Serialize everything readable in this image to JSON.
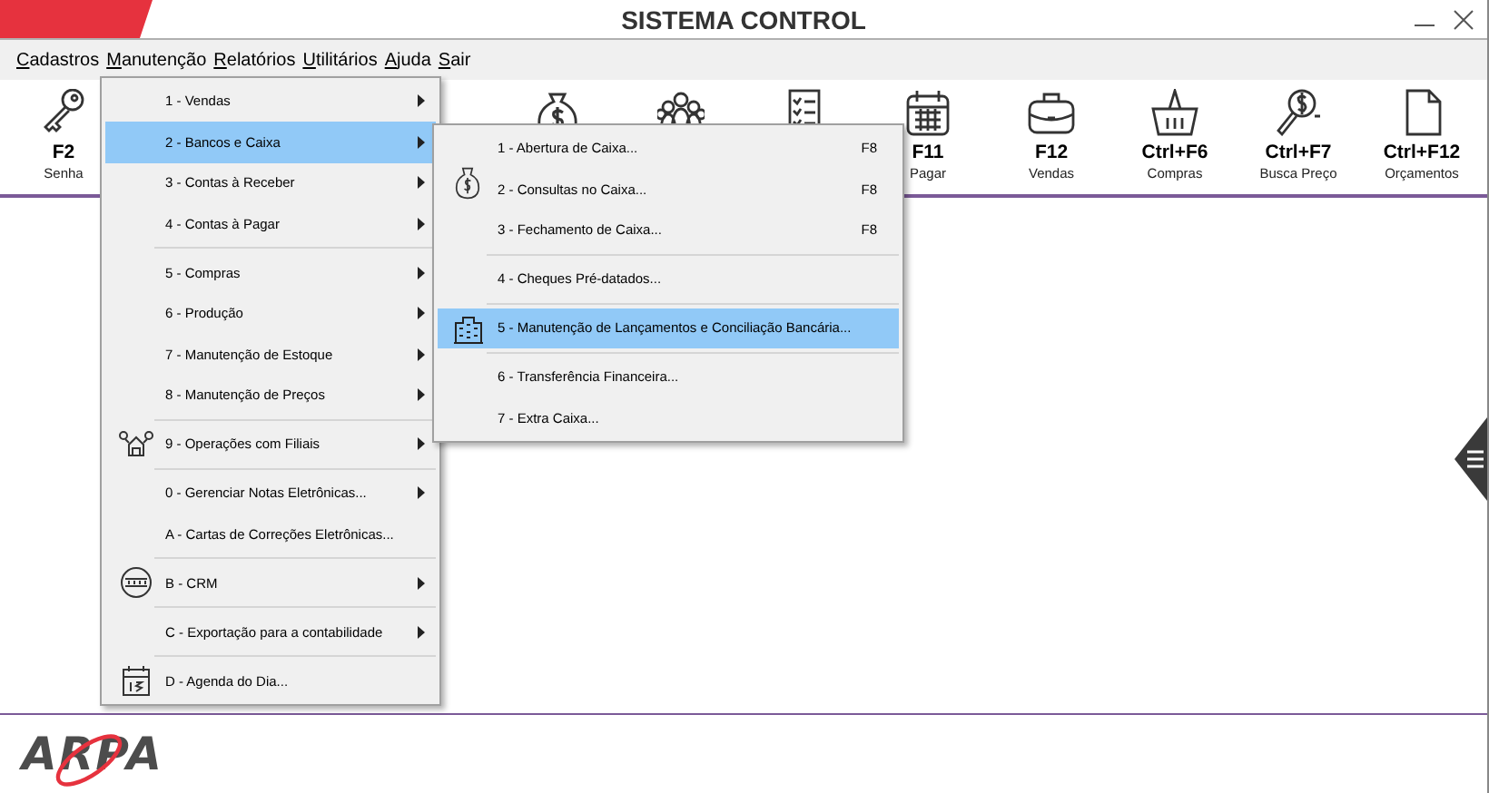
{
  "window": {
    "title": "SISTEMA CONTROL"
  },
  "menubar": [
    {
      "label": "Cadastros"
    },
    {
      "label": "Manutenção"
    },
    {
      "label": "Relatórios"
    },
    {
      "label": "Utilitários"
    },
    {
      "label": "Ajuda"
    },
    {
      "label": "Sair"
    }
  ],
  "toolbar": [
    {
      "kind": "key",
      "key": "F2",
      "label": "Senha"
    },
    {
      "kind": "blank"
    },
    {
      "kind": "blank"
    },
    {
      "kind": "blank"
    },
    {
      "kind": "money"
    },
    {
      "kind": "people"
    },
    {
      "kind": "checklist"
    },
    {
      "kind": "calendar",
      "key": "F11",
      "label": "Pagar"
    },
    {
      "kind": "briefcase",
      "key": "F12",
      "label": "Vendas"
    },
    {
      "kind": "basket",
      "key": "Ctrl+F6",
      "label": "Compras"
    },
    {
      "kind": "price",
      "key": "Ctrl+F7",
      "label": "Busca Preço"
    },
    {
      "kind": "document",
      "key": "Ctrl+F12",
      "label": "Orçamentos"
    }
  ],
  "menu": {
    "groups": [
      [
        {
          "label": "1 - Vendas",
          "submenu": true,
          "selected": false,
          "kind": "plain"
        },
        {
          "label": "2 - Bancos e Caixa",
          "submenu": true,
          "selected": true,
          "kind": "plain"
        },
        {
          "label": "3 - Contas à Receber",
          "submenu": true,
          "selected": false,
          "kind": "plain"
        },
        {
          "label": "4 - Contas à Pagar",
          "submenu": true,
          "selected": false,
          "kind": "plain"
        }
      ],
      [
        {
          "label": "5 - Compras",
          "submenu": true,
          "selected": false,
          "kind": "plain"
        },
        {
          "label": "6 - Produção",
          "submenu": true,
          "selected": false,
          "kind": "plain"
        },
        {
          "label": "7 - Manutenção de Estoque",
          "submenu": true,
          "selected": false,
          "kind": "plain"
        },
        {
          "label": "8 - Manutenção de Preços",
          "submenu": true,
          "selected": false,
          "kind": "plain"
        }
      ],
      [
        {
          "label": "9 - Operações com Filiais",
          "submenu": true,
          "selected": false,
          "kind": "network"
        }
      ],
      [
        {
          "label": "0 - Gerenciar Notas Eletrônicas...",
          "submenu": true,
          "selected": false,
          "kind": "plain"
        },
        {
          "label": "A - Cartas de Correções Eletrônicas...",
          "submenu": false,
          "selected": false,
          "kind": "plain"
        }
      ],
      [
        {
          "label": "B - CRM",
          "submenu": true,
          "selected": false,
          "kind": "crm"
        }
      ],
      [
        {
          "label": "C - Exportação para a contabilidade",
          "submenu": true,
          "selected": false,
          "kind": "plain"
        }
      ],
      [
        {
          "label": "D - Agenda do Dia...",
          "submenu": false,
          "selected": false,
          "kind": "calendar"
        }
      ]
    ]
  },
  "submenu": {
    "groups": [
      [
        {
          "label": "1 - Abertura de Caixa...",
          "shortcut": "F8",
          "selected": false,
          "kind": "plain"
        },
        {
          "label": "2 - Consultas no Caixa...",
          "shortcut": "F8",
          "selected": false,
          "kind": "money"
        },
        {
          "label": "3 - Fechamento de Caixa...",
          "shortcut": "F8",
          "selected": false,
          "kind": "plain"
        }
      ],
      [
        {
          "label": "4 - Cheques Pré-datados...",
          "selected": false,
          "kind": "plain"
        }
      ],
      [
        {
          "label": "5 - Manutenção de Lançamentos e Conciliação Bancária...",
          "selected": true,
          "kind": "bank"
        }
      ],
      [
        {
          "label": "6 - Transferência Financeira...",
          "selected": false,
          "kind": "plain"
        },
        {
          "label": "7 - Extra Caixa...",
          "selected": false,
          "kind": "plain"
        }
      ]
    ]
  },
  "footer": {
    "logo": "ARPA"
  }
}
